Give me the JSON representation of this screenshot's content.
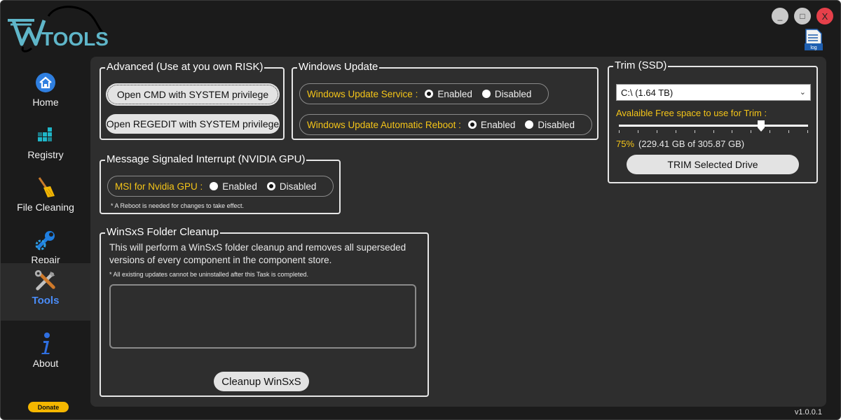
{
  "app": {
    "logo_text": "TOOLS",
    "version": "v1.0.0.1",
    "donate_label": "Donate",
    "log_icon_label": "log",
    "window_controls": {
      "minimize": "_",
      "maximize": "□",
      "close": "X"
    }
  },
  "sidebar": {
    "items": [
      {
        "label": "Home",
        "icon": "home-icon"
      },
      {
        "label": "Registry",
        "icon": "registry-icon"
      },
      {
        "label": "File Cleaning",
        "icon": "broom-icon"
      },
      {
        "label": "Repair",
        "icon": "wrench-icon"
      },
      {
        "label": "Tools",
        "icon": "tools-icon",
        "active": true
      },
      {
        "label": "About",
        "icon": "info-icon"
      }
    ]
  },
  "advanced": {
    "title": "Advanced (Use at you own RISK)",
    "cmd_button": "Open CMD with SYSTEM privilege",
    "regedit_button": "Open REGEDIT with SYSTEM privilege"
  },
  "windows_update": {
    "title": "Windows Update",
    "service_label": "Windows Update Service :",
    "service_enabled": "Enabled",
    "service_disabled": "Disabled",
    "service_value": "Enabled",
    "reboot_label": "Windows Update Automatic Reboot :",
    "reboot_enabled": "Enabled",
    "reboot_disabled": "Disabled",
    "reboot_value": "Enabled"
  },
  "msi": {
    "title": "Message Signaled Interrupt (NVIDIA GPU)",
    "label": "MSI for Nvidia GPU :",
    "enabled": "Enabled",
    "disabled": "Disabled",
    "value": "Disabled",
    "note": "* A Reboot is needed for changes to take effect."
  },
  "winsxs": {
    "title": "WinSxS Folder Cleanup",
    "description": "This will perform a WinSxS folder cleanup and removes all superseded versions of every component in the component store.",
    "note": "* All existing updates cannot be uninstalled after this Task is completed.",
    "output_text": "",
    "button": "Cleanup WinSxS"
  },
  "trim": {
    "title": "Trim (SSD)",
    "drive_selected": "C:\\  (1.64 TB)",
    "free_label": "Avalaible Free space to use for Trim :",
    "percent_label": "75%",
    "percent_value": 0.75,
    "free_detail": "(229.41 GB of 305.87 GB)",
    "button": "TRIM Selected Drive"
  },
  "colors": {
    "accent_yellow": "#f5c518",
    "active_nav": "#4a8cf7",
    "logo_teal": "#5fb6c9",
    "close_red": "#e5404a",
    "panel_bg": "#2e2e2e",
    "window_bg": "#1b1b1b"
  }
}
